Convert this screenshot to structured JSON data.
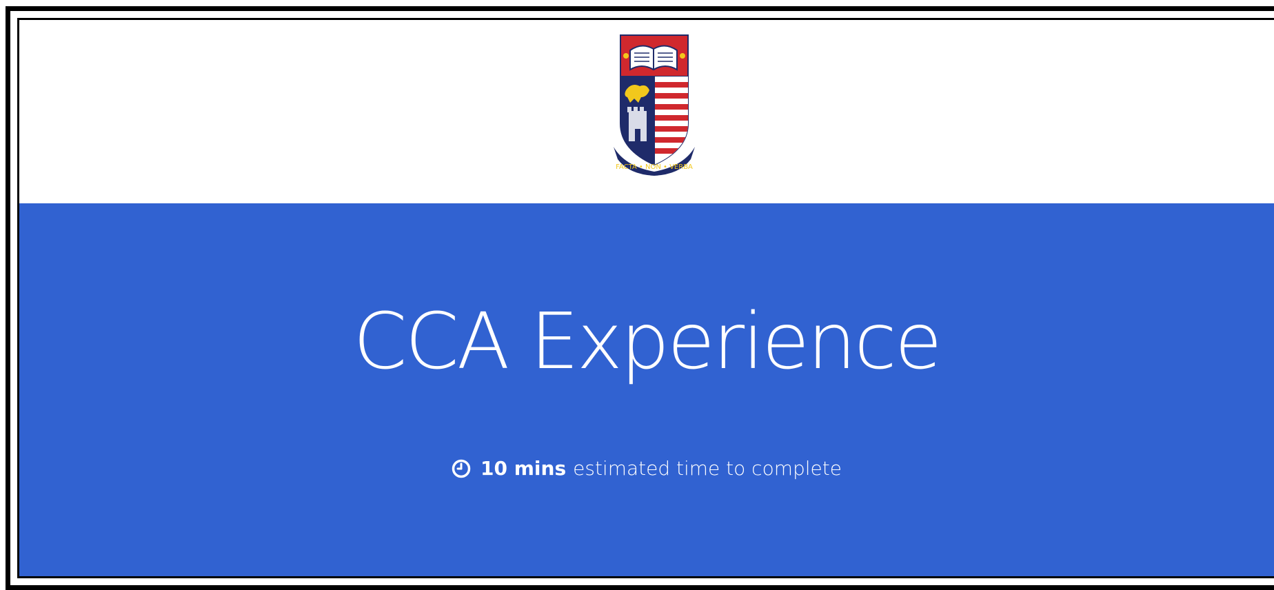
{
  "header": {
    "logo_icon": "school-crest-icon",
    "logo_motto": "FACTA • NON • VERBA"
  },
  "hero": {
    "title": "CCA Experience",
    "time_icon": "clock-icon",
    "time_value": "10 mins",
    "time_label": "estimated time to complete"
  },
  "colors": {
    "hero_background": "#3162d1",
    "hero_text": "#ffffff",
    "frame": "#000000",
    "crest_red": "#d0282e",
    "crest_navy": "#1f2b6a",
    "crest_gold": "#f2c81c"
  }
}
